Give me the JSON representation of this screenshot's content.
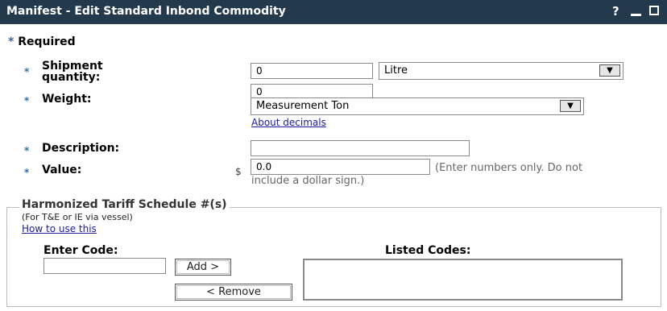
{
  "window": {
    "title": "Manifest - Edit Standard Inbond Commodity",
    "help_label": "?"
  },
  "form": {
    "required_star": "*",
    "required_label": "Required",
    "shipment_quantity": {
      "label_line1": "Shipment",
      "label_line2": "quantity:",
      "value": "0",
      "unit_selected": "Litre"
    },
    "weight": {
      "label": "Weight:",
      "value": "0",
      "unit_selected": "Measurement Ton",
      "about_link": "About decimals"
    },
    "description": {
      "label": "Description:",
      "value": ""
    },
    "value": {
      "label": "Value:",
      "currency_symbol": "$",
      "amount": "0.0",
      "hint_line1": "(Enter numbers only. Do not",
      "hint_line2": "include a dollar sign.)"
    }
  },
  "hts": {
    "legend": "Harmonized Tariff Schedule #(s)",
    "note": "(For T&E or IE via vessel)",
    "how_to_link": "How to use this",
    "enter_code_label": "Enter Code:",
    "enter_code_value": "",
    "add_button": "Add >",
    "remove_button": "< Remove",
    "listed_codes_label": "Listed Codes:"
  }
}
